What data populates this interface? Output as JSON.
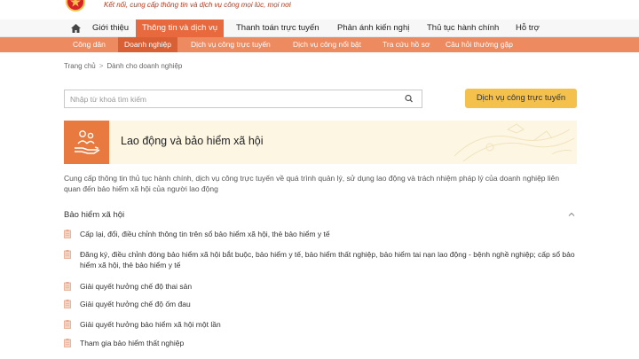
{
  "header": {
    "tagline": "Kết nối, cung cấp thông tin và dịch vụ công mọi lúc, mọi nơi"
  },
  "main_nav": {
    "items": [
      "Giới thiệu",
      "Thông tin và dịch vụ",
      "Thanh toán trực tuyến",
      "Phản ánh kiến nghị",
      "Thủ tục hành chính",
      "Hỗ trợ"
    ],
    "active_index": 1
  },
  "sub_nav": {
    "items": [
      "Công dân",
      "Doanh nghiệp",
      "Dịch vụ công trực tuyến",
      "Dịch vụ công nổi bật",
      "Tra cứu hồ sơ",
      "Câu hỏi thường gặp"
    ],
    "active_index": 1
  },
  "breadcrumb": {
    "home": "Trang chủ",
    "current": "Dành cho doanh nghiệp"
  },
  "search": {
    "placeholder": "Nhập từ khoá tìm kiếm",
    "value": ""
  },
  "cta_label": "Dịch vụ công trực tuyến",
  "banner": {
    "title": "Lao động và bảo hiểm xã hội"
  },
  "description": "Cung cấp thông tin thủ tục hành chính, dịch vụ công trực tuyến về quá trình quản lý, sử dụng lao động và trách nhiệm pháp lý của doanh nghiệp liên quan đến bảo hiểm xã hội của người lao động",
  "section": {
    "title": "Bảo hiểm xã hội",
    "items": [
      "Cấp lại, đổi, điều chỉnh thông tin trên sổ bảo hiểm xã hội, thẻ bảo hiểm y tế",
      "Đăng ký, điều chỉnh đóng bảo hiểm xã hội bắt buộc, bảo hiểm y tế, bảo hiểm thất nghiệp, bảo hiểm tai nạn lao động - bệnh nghề nghiệp; cấp sổ bảo hiểm xã hội, thẻ bảo hiểm y tế",
      "Giải quyết hưởng chế độ thai sản",
      "Giải quyết hưởng chế độ ốm đau",
      "Giải quyết hưởng bảo hiểm xã hội một lần",
      "Tham gia bảo hiểm thất nghiệp"
    ]
  },
  "colors": {
    "primary": "#e8693e",
    "subnav": "#ee8a60",
    "subnav_active": "#d95f34",
    "cta": "#f5c14d",
    "banner_bg": "#fdf6e3",
    "tagline": "#b53a1f"
  },
  "icons": [
    "national-emblem-icon",
    "home-icon",
    "search-icon",
    "family-care-icon",
    "chevron-up-icon",
    "document-icon"
  ]
}
